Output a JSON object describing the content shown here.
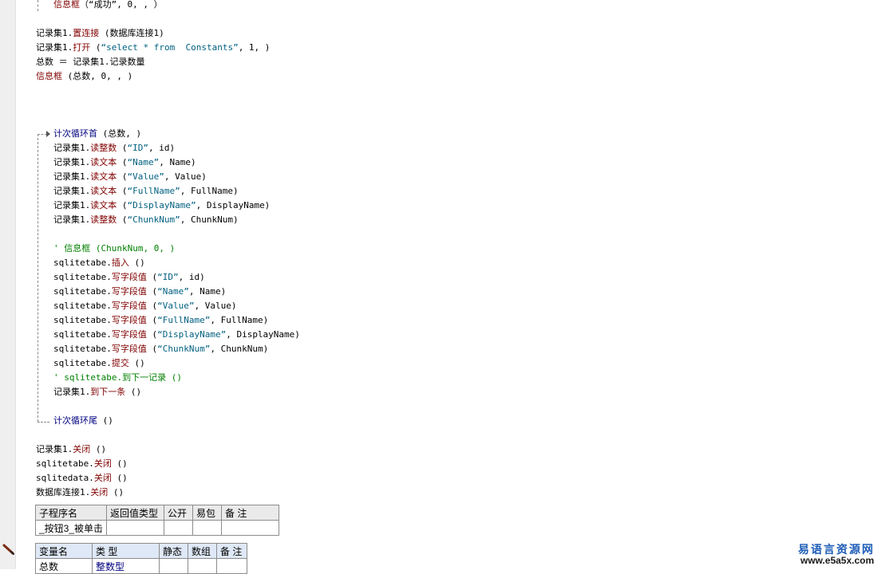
{
  "code": {
    "top_line": {
      "name": "信息框",
      "args": "（“成功”, 0, , ）"
    },
    "lines_a": [
      {
        "obj": "记录集1.",
        "method": "置连接",
        "args": " (数据库连接1)"
      },
      {
        "obj": "记录集1.",
        "method": "打开",
        "args_pre": " (",
        "str": "“select * from  Constants”",
        "args_post": ", 1, )"
      },
      {
        "text": "总数 ＝ 记录集1.记录数量"
      },
      {
        "method": "信息框",
        "args": " (总数, 0, , )"
      }
    ],
    "loop_start": {
      "keyword": "计次循环首",
      "args": " (总数, )"
    },
    "loop_body": [
      {
        "obj": "记录集1.",
        "method": "读整数",
        "args_pre": " (",
        "str": "“ID”",
        "args_post": ", id)"
      },
      {
        "obj": "记录集1.",
        "method": "读文本",
        "args_pre": " (",
        "str": "“Name”",
        "args_post": ", Name)"
      },
      {
        "obj": "记录集1.",
        "method": "读文本",
        "args_pre": " (",
        "str": "“Value”",
        "args_post": ", Value)"
      },
      {
        "obj": "记录集1.",
        "method": "读文本",
        "args_pre": " (",
        "str": "“FullName”",
        "args_post": ", FullName)"
      },
      {
        "obj": "记录集1.",
        "method": "读文本",
        "args_pre": " (",
        "str": "“DisplayName”",
        "args_post": ", DisplayName)"
      },
      {
        "obj": "记录集1.",
        "method": "读整数",
        "args_pre": " (",
        "str": "“ChunkNum”",
        "args_post": ", ChunkNum)"
      }
    ],
    "comment_msg": "' 信息框 (ChunkNum, 0, )",
    "loop_body2": [
      {
        "obj": "sqlitetabe.",
        "method": "插入",
        "args": " ()"
      },
      {
        "obj": "sqlitetabe.",
        "method": "写字段值",
        "args_pre": " (",
        "str": "“ID”",
        "args_post": ", id)"
      },
      {
        "obj": "sqlitetabe.",
        "method": "写字段值",
        "args_pre": " (",
        "str": "“Name”",
        "args_post": ", Name)"
      },
      {
        "obj": "sqlitetabe.",
        "method": "写字段值",
        "args_pre": " (",
        "str": "“Value”",
        "args_post": ", Value)"
      },
      {
        "obj": "sqlitetabe.",
        "method": "写字段值",
        "args_pre": " (",
        "str": "“FullName”",
        "args_post": ", FullName)"
      },
      {
        "obj": "sqlitetabe.",
        "method": "写字段值",
        "args_pre": " (",
        "str": "“DisplayName”",
        "args_post": ", DisplayName)"
      },
      {
        "obj": "sqlitetabe.",
        "method": "写字段值",
        "args_pre": " (",
        "str": "“ChunkNum”",
        "args_post": ", ChunkNum)"
      },
      {
        "obj": "sqlitetabe.",
        "method": "提交",
        "args": " ()"
      }
    ],
    "comment_next": "' sqlitetabe.到下一记录 ()",
    "next_line": {
      "obj": "记录集1.",
      "method": "到下一条",
      "args": " ()"
    },
    "loop_end": {
      "keyword": "计次循环尾",
      "args": " ()"
    },
    "lines_close": [
      {
        "obj": "记录集1.",
        "method": "关闭",
        "args": " ()"
      },
      {
        "obj": "sqlitetabe.",
        "method": "关闭",
        "args": " ()"
      },
      {
        "obj": "sqlitedata.",
        "method": "关闭",
        "args": " ()"
      },
      {
        "obj": "数据库连接1.",
        "method": "关闭",
        "args": " ()"
      }
    ]
  },
  "sub_table": {
    "headers": [
      "子程序名",
      "返回值类型",
      "公开",
      "易包",
      "备 注"
    ],
    "row": [
      "_按钮3_被单击",
      "",
      "",
      "",
      ""
    ]
  },
  "var_table": {
    "headers": [
      "变量名",
      "类 型",
      "静态",
      "数组",
      "备 注"
    ],
    "row": [
      "总数",
      "整数型",
      "",
      "",
      ""
    ]
  },
  "watermark": {
    "cn": "易语言资源网",
    "url": "www.e5a5x.com"
  },
  "colors": {
    "method": "#800000",
    "string": "#006080",
    "keyword": "#000080",
    "comment": "#008000",
    "watermark": "#1e5db8"
  }
}
